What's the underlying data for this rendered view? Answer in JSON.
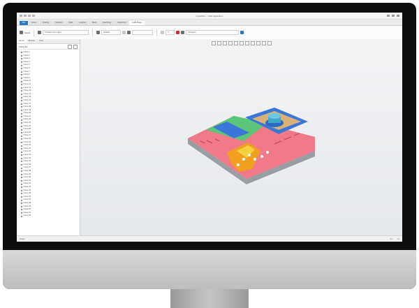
{
  "window": {
    "title": "hyperMILL - CAM Application"
  },
  "ribbon": {
    "tabs": [
      {
        "label": "File",
        "kind": "file"
      },
      {
        "label": "Home"
      },
      {
        "label": "Drafting"
      },
      {
        "label": "Surfaces"
      },
      {
        "label": "Solid"
      },
      {
        "label": "Analysis"
      },
      {
        "label": "Mesh"
      },
      {
        "label": "Machining"
      },
      {
        "label": "Customize"
      },
      {
        "label": "CAM Plugin",
        "kind": "active"
      }
    ]
  },
  "toolbar": {
    "group1_label": "Select",
    "field1": "Shaded with edges",
    "field2": "",
    "layer_label": "Default",
    "dropdown_value": "0",
    "right_label": "All layers"
  },
  "panel": {
    "tabs": [
      "Job list",
      "Browser",
      "Tools"
    ],
    "header": "Frame list",
    "items": [
      "Frame 1",
      "Frame 2",
      "Frame 3",
      "Frame 4",
      "Frame 5",
      "Frame 6",
      "Frame 7",
      "Frame 8",
      "Frame 9",
      "Frame 10",
      "Frame 11",
      "Frame 12",
      "Frame 13",
      "Frame 14",
      "Frame 15",
      "Frame 16",
      "Frame 17",
      "Frame 18",
      "Frame 19",
      "Frame 20",
      "Frame 21",
      "Frame 22",
      "Frame 23",
      "Frame 24",
      "Frame 25",
      "Frame 26",
      "Frame 27",
      "Frame 28",
      "Frame 29",
      "Frame 30",
      "Frame 31",
      "Frame 32",
      "Frame 33",
      "Frame 34",
      "Frame 35",
      "Frame 36",
      "Frame 37",
      "Frame 38",
      "Frame 39",
      "Frame 40",
      "Frame 41",
      "Frame 42",
      "Frame 43",
      "Frame 44",
      "Frame 45",
      "Frame 46",
      "Frame 47",
      "Frame 48",
      "Frame 49",
      "Frame 50",
      "Frame 51",
      "Frame 52"
    ]
  },
  "statusbar": {
    "left": "Ready",
    "right1": "mm",
    "right2": "1:1"
  },
  "colors": {
    "accent": "#2e78c4",
    "part_pink": "#f07a8a",
    "part_green": "#5cc57a",
    "part_blue": "#3c77d8",
    "part_orange": "#f0a020",
    "part_tan": "#d8b27a",
    "part_cyan": "#3fa7c9"
  }
}
